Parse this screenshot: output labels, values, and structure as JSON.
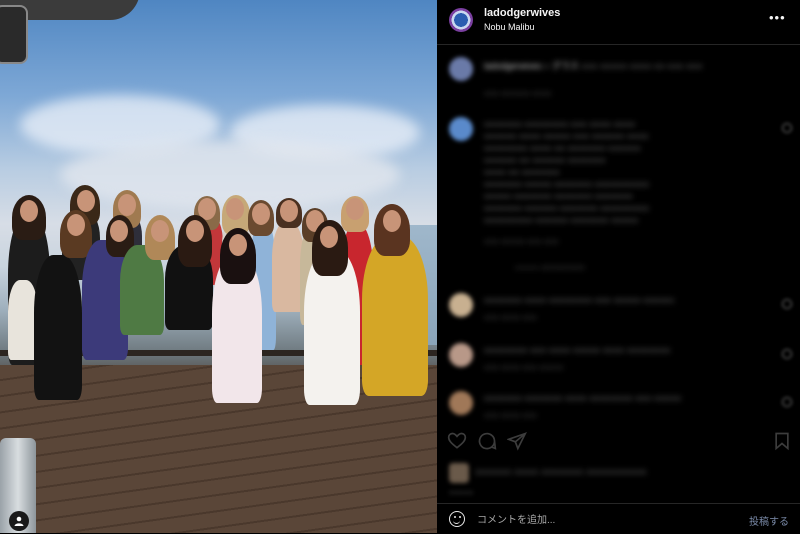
{
  "post": {
    "username": "ladodgerwives",
    "location": "Nobu Malibu",
    "more_icon": "more-horizontal-icon"
  },
  "comments": [
    {
      "text": "ladodgerwives ○ グラス ○○○ ○○○○○ ○○○○ ○○ ○○○ ○○○",
      "meta": "○○○ ○○○○○○ ○○○○"
    },
    {
      "text": "○○○○○○○ ○○ ○○○○○○○○ ○○○ ○○○○ ○○○○○ ○○○○",
      "meta": "○○○ ○○○○○ ○○○ ○○○"
    },
    {
      "text": "○○○○○○○ ○○○○ ○○○○○○○○ ○○○ ○○○○○ ○○○○○○ ○○",
      "meta": "○○○ ○○○○ ○○○"
    },
    {
      "text": "○○○○○○○○ ○○○ ○○○○ ○○○○○ ○○○○ ○○○○○○○○",
      "meta": "○○○ ○○○○ ○○○ ○○○○○"
    },
    {
      "text": "○○○○○○○ ○○○○○○○ ○○○○ ○○○○○○○○ ○○○ ○○○○○",
      "meta": "○○○ ○○○○ ○○○"
    }
  ],
  "input": {
    "placeholder": "コメントを追加...",
    "post_label": "投稿する"
  },
  "colors": {
    "panel_bg": "#000000",
    "post_button": "#7a8aa8",
    "divider": "#262626"
  }
}
